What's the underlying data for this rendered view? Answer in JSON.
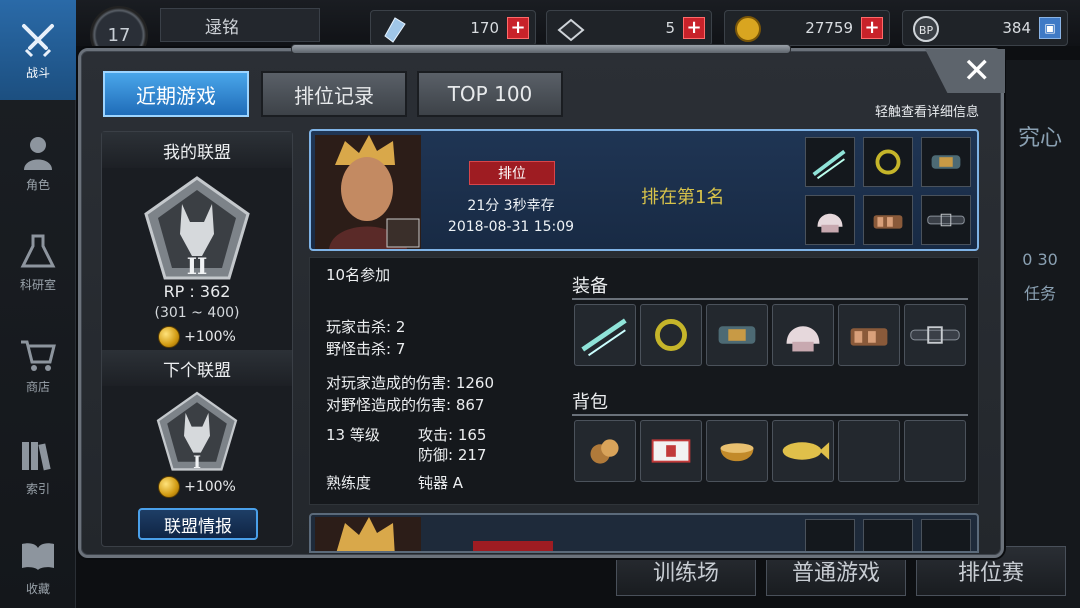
{
  "nav": {
    "items": [
      {
        "label": "战斗",
        "icon": "crossed-swords-icon"
      },
      {
        "label": "角色",
        "icon": "character-icon"
      },
      {
        "label": "科研室",
        "icon": "flask-icon"
      },
      {
        "label": "商店",
        "icon": "cart-icon"
      },
      {
        "label": "索引",
        "icon": "books-icon"
      },
      {
        "label": "收藏",
        "icon": "book-icon"
      }
    ]
  },
  "player": {
    "level": "17",
    "name": "逯铭"
  },
  "resources": [
    {
      "icon": "crystal-icon",
      "value": "170"
    },
    {
      "icon": "token-icon",
      "value": "5"
    },
    {
      "icon": "gold-coin-icon",
      "value": "27759"
    },
    {
      "icon": "bp-icon",
      "value": "384"
    }
  ],
  "background": {
    "right_text_1": "究心",
    "right_text_2": "0 30",
    "right_text_3": "任务",
    "bottom_buttons": [
      "训练场",
      "普通游戏",
      "排位赛"
    ]
  },
  "modal": {
    "tabs": [
      "近期游戏",
      "排位记录",
      "TOP 100"
    ],
    "active_tab": 0,
    "hint": "轻触查看详细信息",
    "close": "✕"
  },
  "league": {
    "my_title": "我的联盟",
    "my_rank": "II",
    "rp": "RP : 362",
    "rp_range": "(301 ~ 400)",
    "my_bonus": "+100%",
    "next_title": "下个联盟",
    "next_rank": "I",
    "next_bonus": "+100%",
    "button": "联盟情报"
  },
  "match": {
    "mode": "排位",
    "survival": "21分 3秒幸存",
    "datetime": "2018-08-31 15:09",
    "rank_text": "排在第1名",
    "equip_icons": [
      "blade-icon",
      "ring-icon",
      "bracer-icon",
      "helmet-icon",
      "gauntlet-icon",
      "belt-icon"
    ]
  },
  "detail": {
    "participants": "10名参加",
    "player_kills": "玩家击杀: 2",
    "monster_kills": "野怪击杀: 7",
    "damage_players": "对玩家造成的伤害: 1260",
    "damage_monsters": "对野怪造成的伤害: 867",
    "level": "13 等级",
    "attack": "攻击: 165",
    "defense": "防御: 217",
    "mastery_label": "熟练度",
    "mastery_value": "钝器 A",
    "equipment_title": "装备",
    "backpack_title": "背包",
    "equipment": [
      "blade-icon",
      "ring-icon",
      "bracer-icon",
      "helmet-icon",
      "gauntlet-icon",
      "belt-icon"
    ],
    "backpack": [
      "cookies-icon",
      "bandage-box-icon",
      "bowl-icon",
      "fish-icon",
      "",
      ""
    ]
  }
}
